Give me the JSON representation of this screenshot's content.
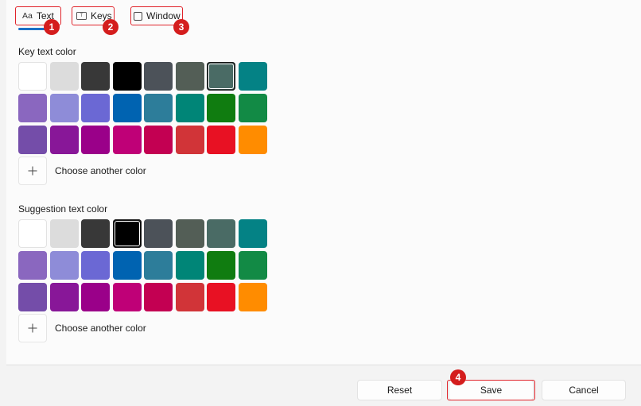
{
  "tabs": [
    {
      "icon_text": "Aa",
      "label": "Text"
    },
    {
      "icon_text": "T",
      "label": "Keys"
    },
    {
      "label": "Window"
    }
  ],
  "key_text": {
    "label": "Key text color",
    "choose_label": "Choose another color",
    "selected_index": 6
  },
  "suggestion_text": {
    "label": "Suggestion text color",
    "choose_label": "Choose another color",
    "selected_index": 3
  },
  "palette": [
    "#ffffff",
    "#dcdcdc",
    "#383838",
    "#000000",
    "#4c5259",
    "#535e56",
    "#4a6b65",
    "#048285",
    "#8a67bf",
    "#8e8cd8",
    "#6b68d4",
    "#0063b1",
    "#2d7d9a",
    "#008577",
    "#107c10",
    "#128a45",
    "#744da9",
    "#881798",
    "#9a0089",
    "#bf0077",
    "#c30052",
    "#d13438",
    "#e81123",
    "#ff8c00"
  ],
  "footer": {
    "reset_label": "Reset",
    "save_label": "Save",
    "cancel_label": "Cancel"
  },
  "badges": [
    "1",
    "2",
    "3",
    "4"
  ],
  "colors": {
    "accent": "#1a6fc7",
    "callout_red": "#e0242b"
  }
}
